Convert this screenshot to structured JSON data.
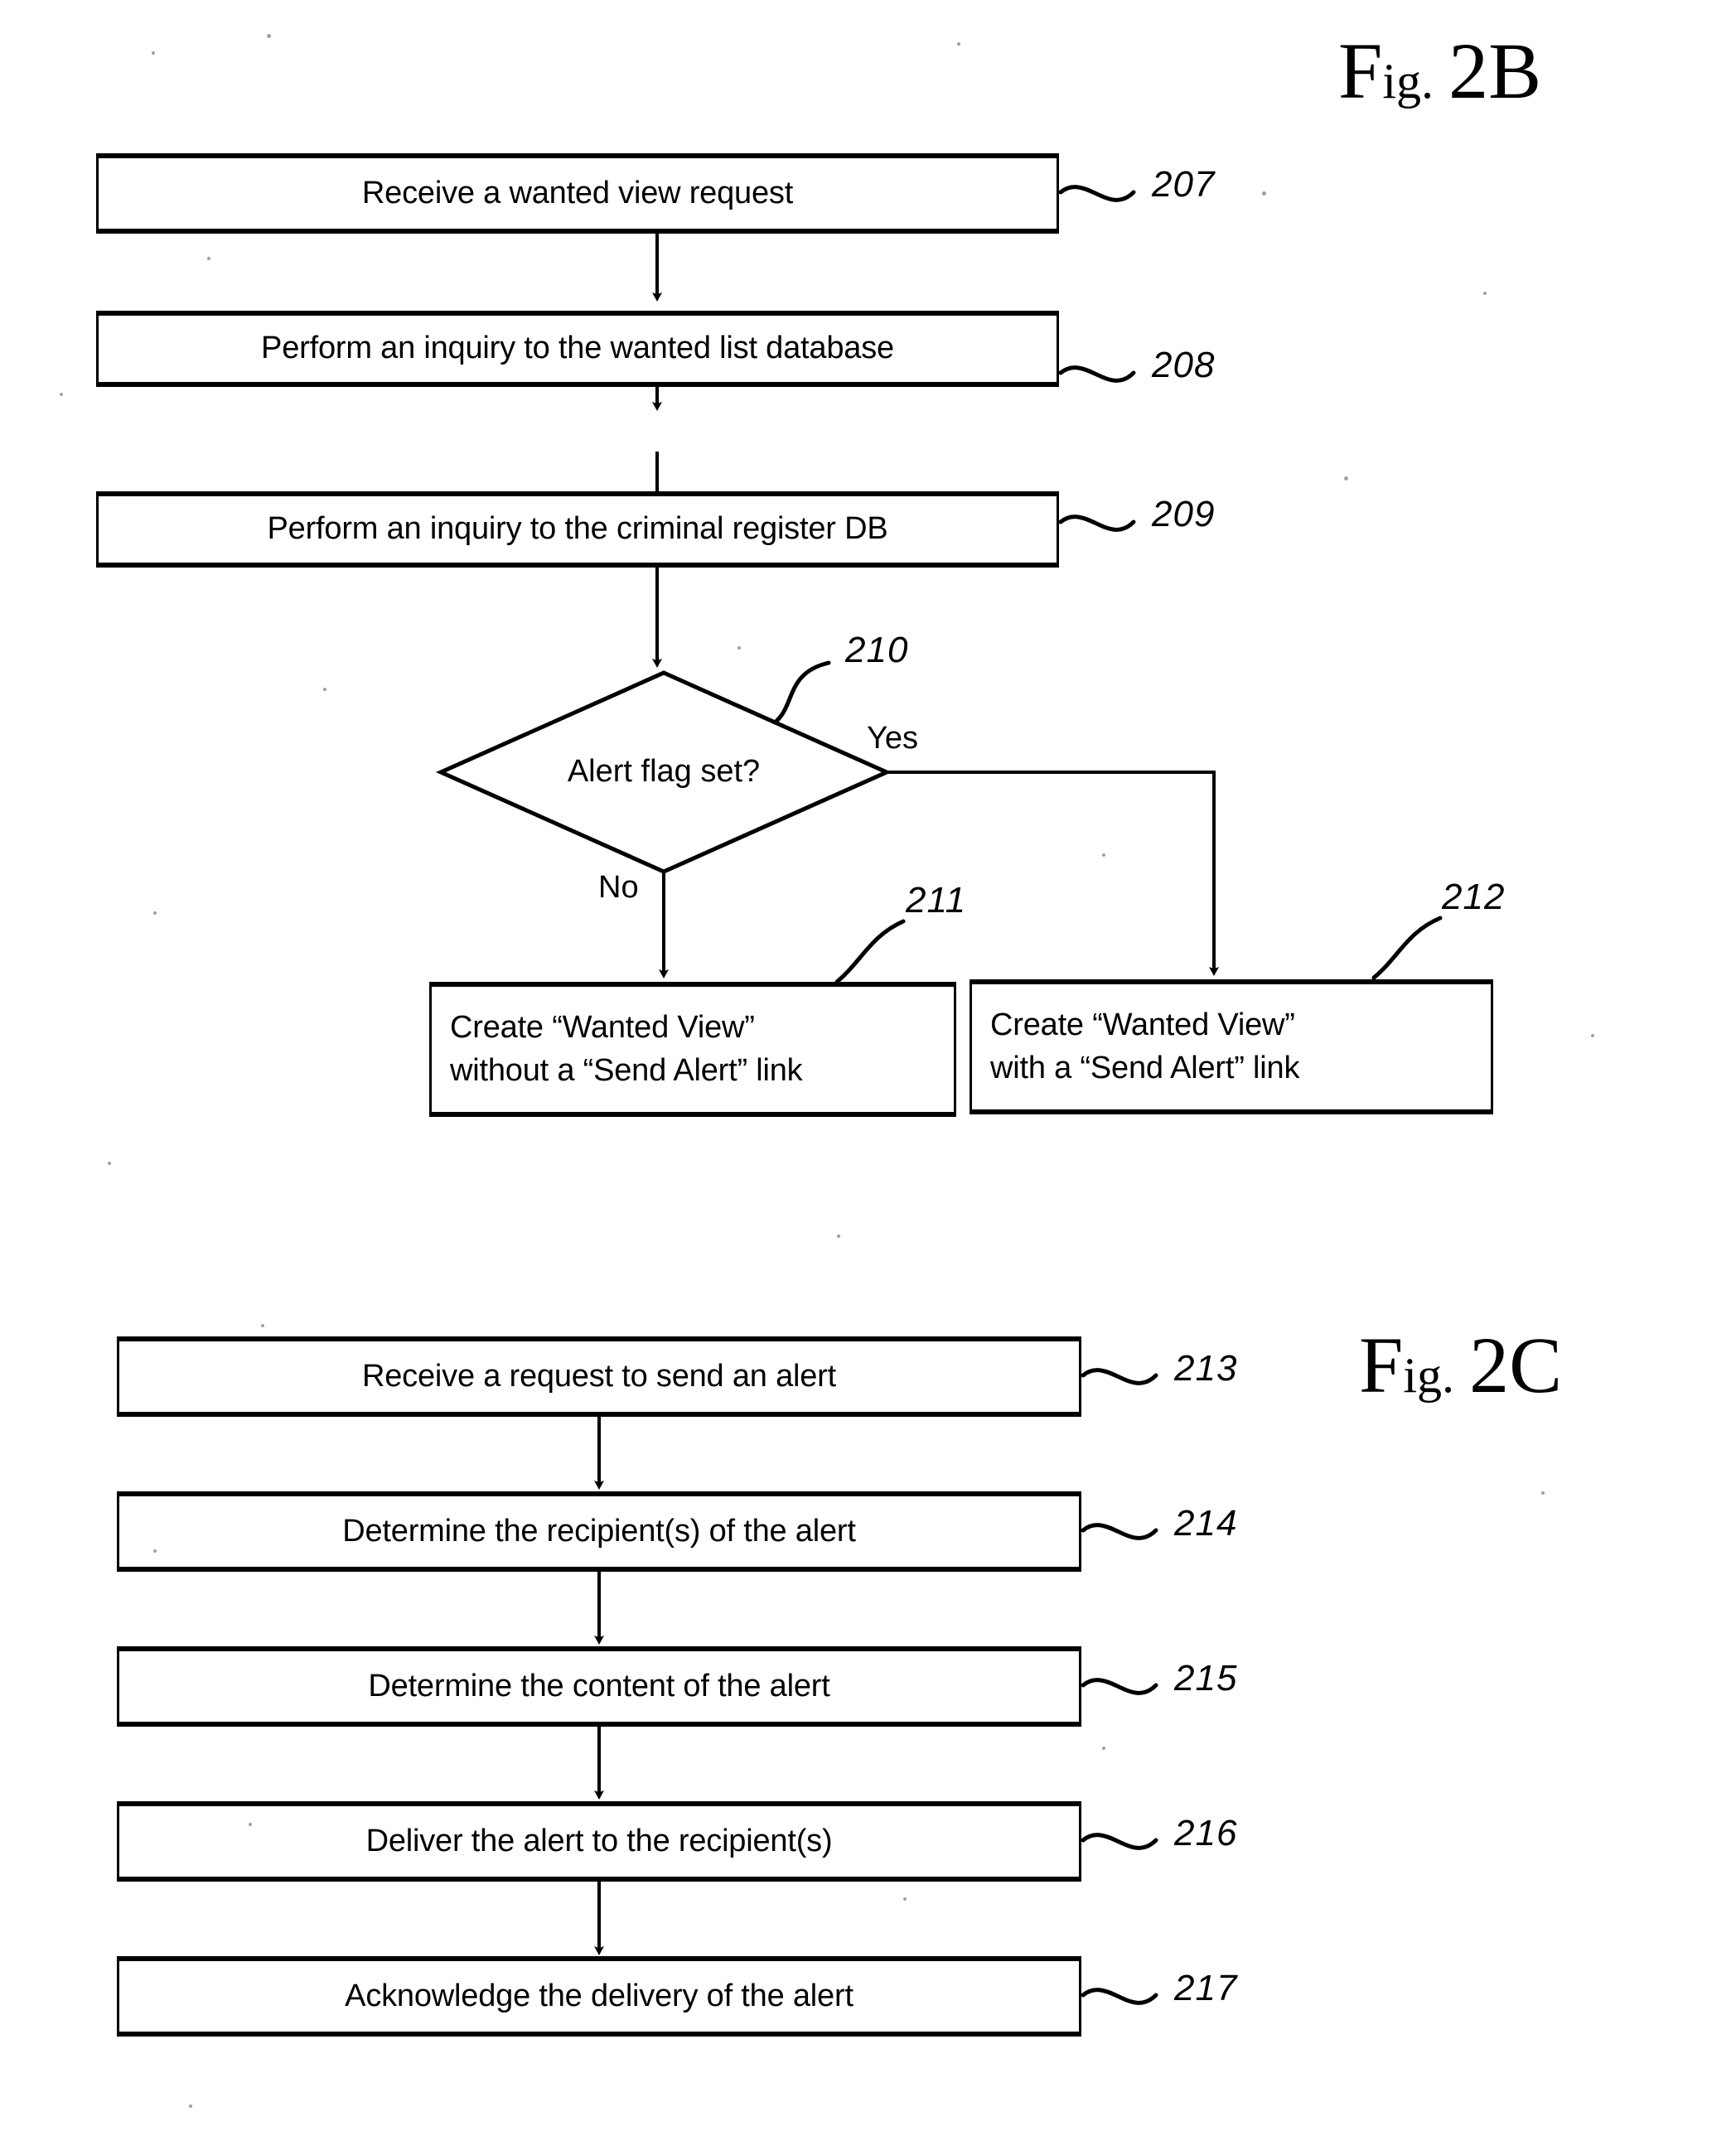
{
  "figures": [
    {
      "id": "fig-2b",
      "title_prefix": "F",
      "title_small": "ig.",
      "title_number": "2B"
    },
    {
      "id": "fig-2c",
      "title_prefix": "F",
      "title_small": "ig.",
      "title_number": "2C"
    }
  ],
  "fig2b": {
    "title": "Fig. 2B",
    "steps": [
      {
        "ref": "207",
        "text": "Receive a wanted view request"
      },
      {
        "ref": "208",
        "text": "Perform an inquiry to the wanted list database"
      },
      {
        "ref": "209",
        "text": "Perform an inquiry to the criminal register DB"
      }
    ],
    "decision": {
      "ref": "210",
      "text": "Alert flag set?",
      "yes_label": "Yes",
      "no_label": "No"
    },
    "outcomes": [
      {
        "ref": "211",
        "line1": "Create “Wanted View”",
        "line2": "without a “Send Alert” link"
      },
      {
        "ref": "212",
        "line1": "Create “Wanted View”",
        "line2": "with a “Send Alert” link"
      }
    ]
  },
  "fig2c": {
    "title": "Fig. 2C",
    "steps": [
      {
        "ref": "213",
        "text": "Receive a request to send an alert"
      },
      {
        "ref": "214",
        "text": "Determine the recipient(s) of the alert"
      },
      {
        "ref": "215",
        "text": "Determine the content of the alert"
      },
      {
        "ref": "216",
        "text": "Deliver the alert to the recipient(s)"
      },
      {
        "ref": "217",
        "text": "Acknowledge the delivery of the alert"
      }
    ]
  },
  "colors": {
    "ink": "#000000",
    "paper": "#ffffff"
  }
}
